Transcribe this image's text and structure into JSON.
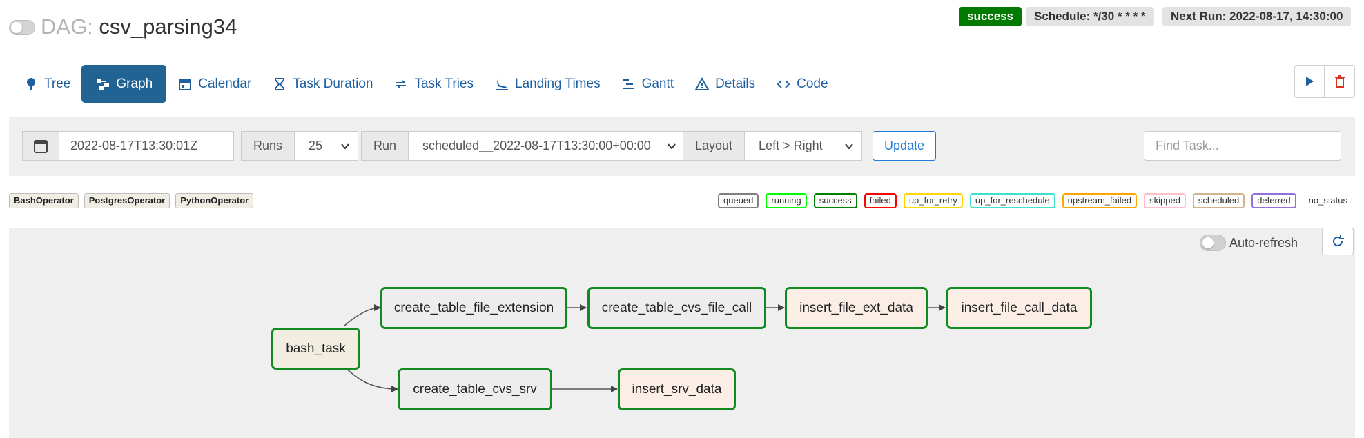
{
  "header": {
    "dag_prefix": "DAG:",
    "dag_id": "csv_parsing34",
    "status_badge": "success",
    "schedule": "Schedule: */30 * * * *",
    "next_run": "Next Run: 2022-08-17, 14:30:00"
  },
  "nav": {
    "tabs": [
      {
        "label": "Tree",
        "icon": "tree-pin-icon",
        "active": false
      },
      {
        "label": "Graph",
        "icon": "graph-icon",
        "active": true
      },
      {
        "label": "Calendar",
        "icon": "calendar-icon",
        "active": false
      },
      {
        "label": "Task Duration",
        "icon": "hourglass-icon",
        "active": false
      },
      {
        "label": "Task Tries",
        "icon": "retry-icon",
        "active": false
      },
      {
        "label": "Landing Times",
        "icon": "plane-landing-icon",
        "active": false
      },
      {
        "label": "Gantt",
        "icon": "gantt-icon",
        "active": false
      },
      {
        "label": "Details",
        "icon": "warning-triangle-icon",
        "active": false
      },
      {
        "label": "Code",
        "icon": "code-icon",
        "active": false
      }
    ]
  },
  "filters": {
    "base_date": "2022-08-17T13:30:01Z",
    "runs_label": "Runs",
    "runs_value": "25",
    "run_label": "Run",
    "run_value": "scheduled__2022-08-17T13:30:00+00:00",
    "layout_label": "Layout",
    "layout_value": "Left > Right",
    "update_label": "Update",
    "find_task_placeholder": "Find Task..."
  },
  "operators": [
    "BashOperator",
    "PostgresOperator",
    "PythonOperator"
  ],
  "states": [
    {
      "label": "queued",
      "color": "#808080"
    },
    {
      "label": "running",
      "color": "#00ff00"
    },
    {
      "label": "success",
      "color": "#008000"
    },
    {
      "label": "failed",
      "color": "#ff0000"
    },
    {
      "label": "up_for_retry",
      "color": "#ffd700"
    },
    {
      "label": "up_for_reschedule",
      "color": "#40e0d0"
    },
    {
      "label": "upstream_failed",
      "color": "#ffa500"
    },
    {
      "label": "skipped",
      "color": "#ffc0cb"
    },
    {
      "label": "scheduled",
      "color": "#d2b48c"
    },
    {
      "label": "deferred",
      "color": "#9370db"
    },
    {
      "label": "no_status",
      "color": ""
    }
  ],
  "graph": {
    "auto_refresh_label": "Auto-refresh",
    "tasks": [
      {
        "id": "bash_task",
        "operator": "BashOperator",
        "state": "success"
      },
      {
        "id": "create_table_file_extension",
        "operator": "PostgresOperator",
        "state": "success"
      },
      {
        "id": "create_table_cvs_file_call",
        "operator": "PostgresOperator",
        "state": "success"
      },
      {
        "id": "insert_file_ext_data",
        "operator": "PythonOperator",
        "state": "success"
      },
      {
        "id": "insert_file_call_data",
        "operator": "PythonOperator",
        "state": "success"
      },
      {
        "id": "create_table_cvs_srv",
        "operator": "PostgresOperator",
        "state": "success"
      },
      {
        "id": "insert_srv_data",
        "operator": "PythonOperator",
        "state": "success"
      }
    ]
  }
}
